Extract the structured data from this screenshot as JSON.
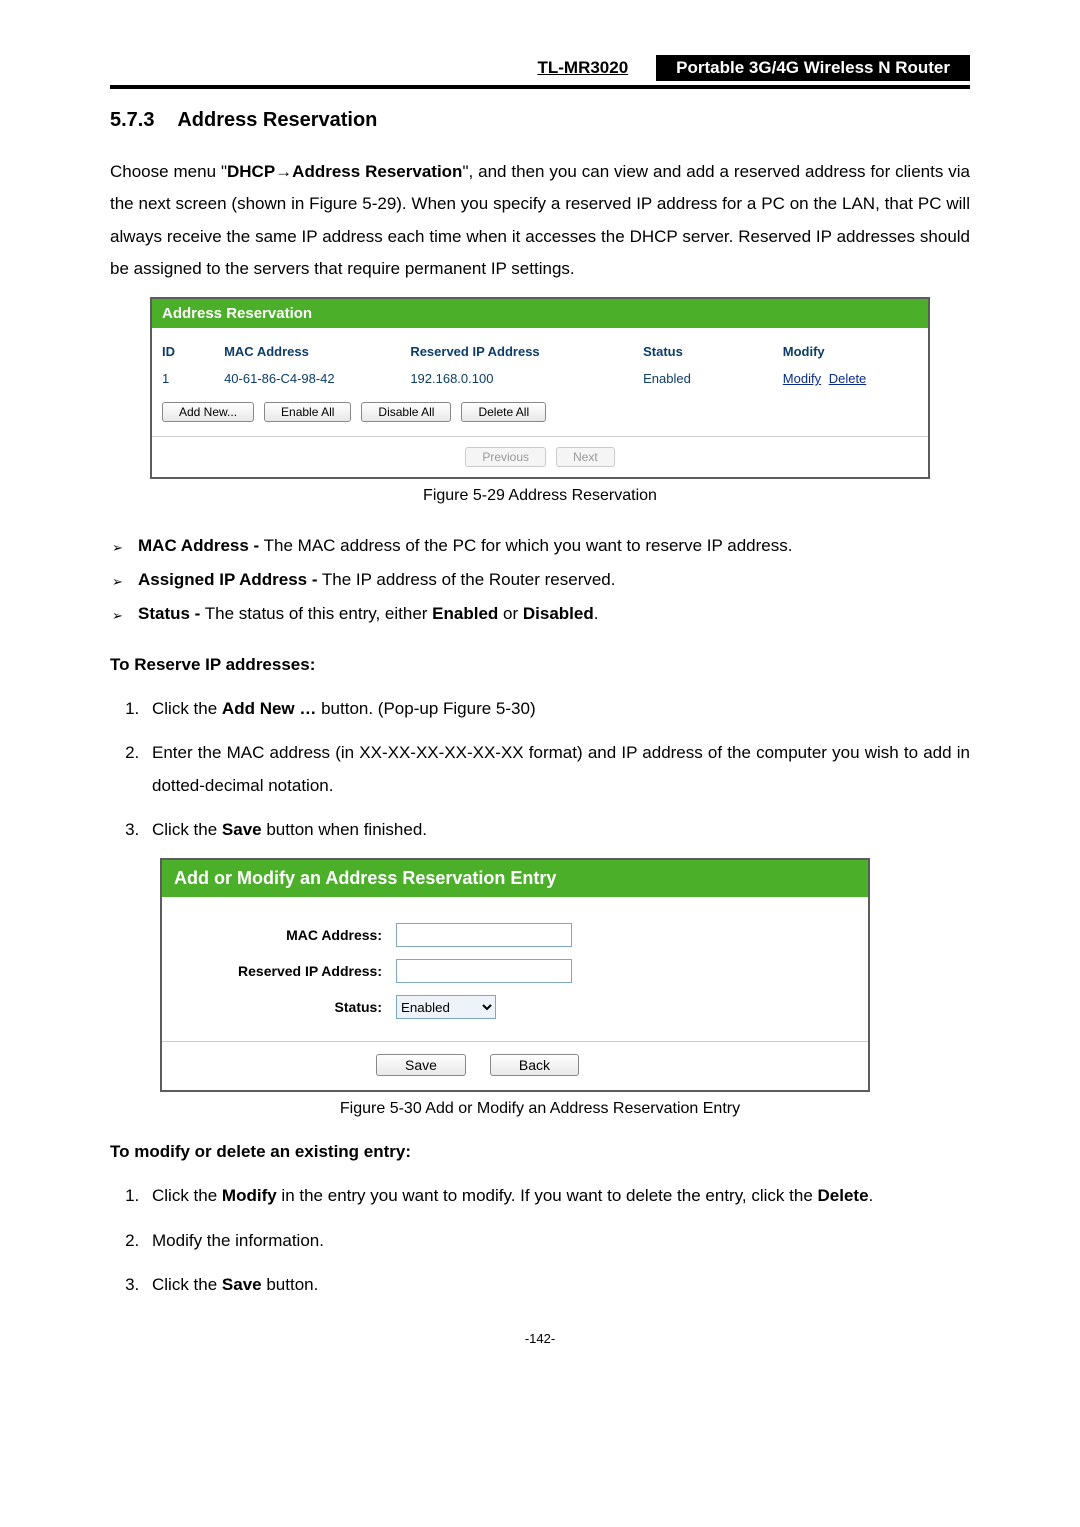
{
  "header": {
    "model": "TL-MR3020",
    "product": "Portable 3G/4G Wireless N Router"
  },
  "section": {
    "number": "5.7.3",
    "title": "Address Reservation"
  },
  "intro": {
    "pre": "Choose menu \"",
    "bold1": "DHCP",
    "arrow": "→",
    "bold2": "Address Reservation",
    "rest": "\", and then you can view and add a reserved address for clients via the next screen (shown in Figure 5-29). When you specify a reserved IP address for a PC on the LAN, that PC will always receive the same IP address each time when it accesses the DHCP server. Reserved IP addresses should be assigned to the servers that require permanent IP settings."
  },
  "fig529": {
    "title": "Address Reservation",
    "headers": {
      "id": "ID",
      "mac": "MAC Address",
      "ip": "Reserved IP Address",
      "status": "Status",
      "modify": "Modify"
    },
    "row": {
      "id": "1",
      "mac": "40-61-86-C4-98-42",
      "ip": "192.168.0.100",
      "status": "Enabled",
      "modify": "Modify",
      "delete": "Delete"
    },
    "buttons": {
      "add": "Add New...",
      "enable": "Enable All",
      "disable": "Disable All",
      "deleteall": "Delete All",
      "prev": "Previous",
      "next": "Next"
    },
    "caption": "Figure 5-29    Address Reservation"
  },
  "bullets": {
    "b1_label": "MAC Address -",
    "b1_text": " The MAC address of the PC for which you want to reserve IP address.",
    "b2_label": "Assigned IP Address -",
    "b2_text": " The IP address of the Router reserved.",
    "b3_label": "Status -",
    "b3_text_a": " The status of this entry, either ",
    "b3_enabled": "Enabled",
    "b3_or": " or ",
    "b3_disabled": "Disabled",
    "b3_end": "."
  },
  "reserve_head": "To Reserve IP addresses:",
  "reserve_steps": {
    "s1a": "Click the ",
    "s1b": "Add New …",
    "s1c": " button. (Pop-up Figure 5-30)",
    "s2": "Enter the MAC address (in XX-XX-XX-XX-XX-XX format) and IP address of the computer you wish to add in dotted-decimal notation.",
    "s3a": "Click the ",
    "s3b": "Save",
    "s3c": " button when finished."
  },
  "fig530": {
    "title": "Add or Modify an Address Reservation Entry",
    "labels": {
      "mac": "MAC Address:",
      "ip": "Reserved IP Address:",
      "status": "Status:"
    },
    "status_value": "Enabled",
    "buttons": {
      "save": "Save",
      "back": "Back"
    },
    "caption": "Figure 5-30    Add or Modify an Address Reservation Entry"
  },
  "modify_head": "To modify or delete an existing entry:",
  "modify_steps": {
    "s1a": "Click the ",
    "s1b": "Modify",
    "s1c": " in the entry you want to modify. If you want to delete the entry, click the ",
    "s1d": "Delete",
    "s1e": ".",
    "s2": "Modify the information.",
    "s3a": "Click the ",
    "s3b": "Save",
    "s3c": " button."
  },
  "page_number": "-142-"
}
